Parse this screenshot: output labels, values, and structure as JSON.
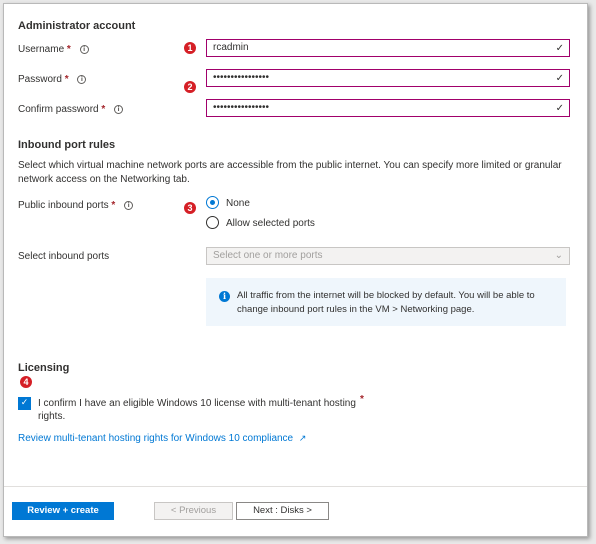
{
  "admin": {
    "title": "Administrator account",
    "username_label": "Username",
    "username_value": "rcadmin",
    "password_label": "Password",
    "password_value": "••••••••••••••••",
    "confirm_label": "Confirm password",
    "confirm_value": "••••••••••••••••",
    "required_mark": "*",
    "info_glyph": "i",
    "valid_glyph": "✓"
  },
  "badges": [
    "1",
    "2",
    "3",
    "4"
  ],
  "inbound": {
    "title": "Inbound port rules",
    "description": "Select which virtual machine network ports are accessible from the public internet. You can specify more limited or granular network access on the Networking tab.",
    "public_ports_label": "Public inbound ports",
    "option_none": "None",
    "option_allow": "Allow selected ports",
    "select_ports_label": "Select inbound ports",
    "select_placeholder": "Select one or more ports",
    "info_text": "All traffic from the internet will be blocked by default. You will be able to change inbound port rules in the VM > Networking page."
  },
  "licensing": {
    "title": "Licensing",
    "confirm_text": "I confirm I have an eligible Windows 10 license with multi-tenant hosting rights.",
    "confirm_checked": true,
    "link_text": "Review multi-tenant hosting rights for Windows 10 compliance"
  },
  "footer": {
    "review_create": "Review + create",
    "previous": "< Previous",
    "next": "Next : Disks >"
  },
  "colors": {
    "accent": "#0078d4",
    "field_border": "#a1006b",
    "badge": "#d51f26"
  }
}
